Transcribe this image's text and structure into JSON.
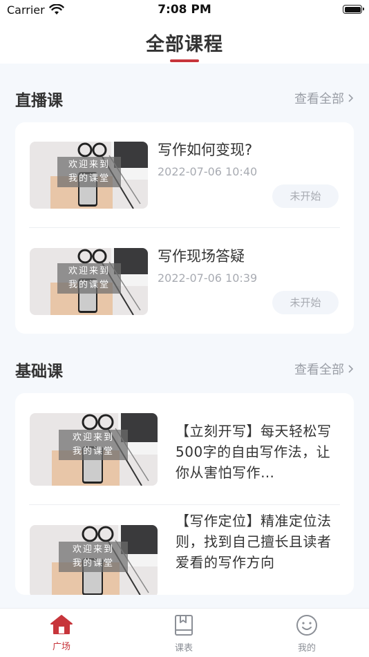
{
  "status_bar": {
    "carrier": "Carrier",
    "time": "7:08 PM"
  },
  "header": {
    "title": "全部课程"
  },
  "live_section": {
    "title": "直播课",
    "view_all": "查看全部",
    "items": [
      {
        "thumb_line1": "欢迎来到",
        "thumb_line2": "我的课堂",
        "title": "写作如何变现?",
        "time": "2022-07-06 10:40",
        "status": "未开始"
      },
      {
        "thumb_line1": "欢迎来到",
        "thumb_line2": "我的课堂",
        "title": "写作现场答疑",
        "time": "2022-07-06 10:39",
        "status": "未开始"
      }
    ]
  },
  "basic_section": {
    "title": "基础课",
    "view_all": "查看全部",
    "items": [
      {
        "thumb_line1": "欢迎来到",
        "thumb_line2": "我的课堂",
        "title": "【立刻开写】每天轻松写500字的自由写作法，让你从害怕写作…"
      },
      {
        "thumb_line1": "欢迎来到",
        "thumb_line2": "我的课堂",
        "title": "【写作定位】精准定位法则，找到自己擅长且读者爱看的写作方向"
      }
    ]
  },
  "tabbar": {
    "tabs": [
      {
        "label": "广场",
        "icon": "home-icon",
        "active": true
      },
      {
        "label": "课表",
        "icon": "book-icon",
        "active": false
      },
      {
        "label": "我的",
        "icon": "smiley-icon",
        "active": false
      }
    ]
  },
  "colors": {
    "accent": "#c7353b",
    "background": "#f5f8fc",
    "muted": "#a8abb2"
  }
}
